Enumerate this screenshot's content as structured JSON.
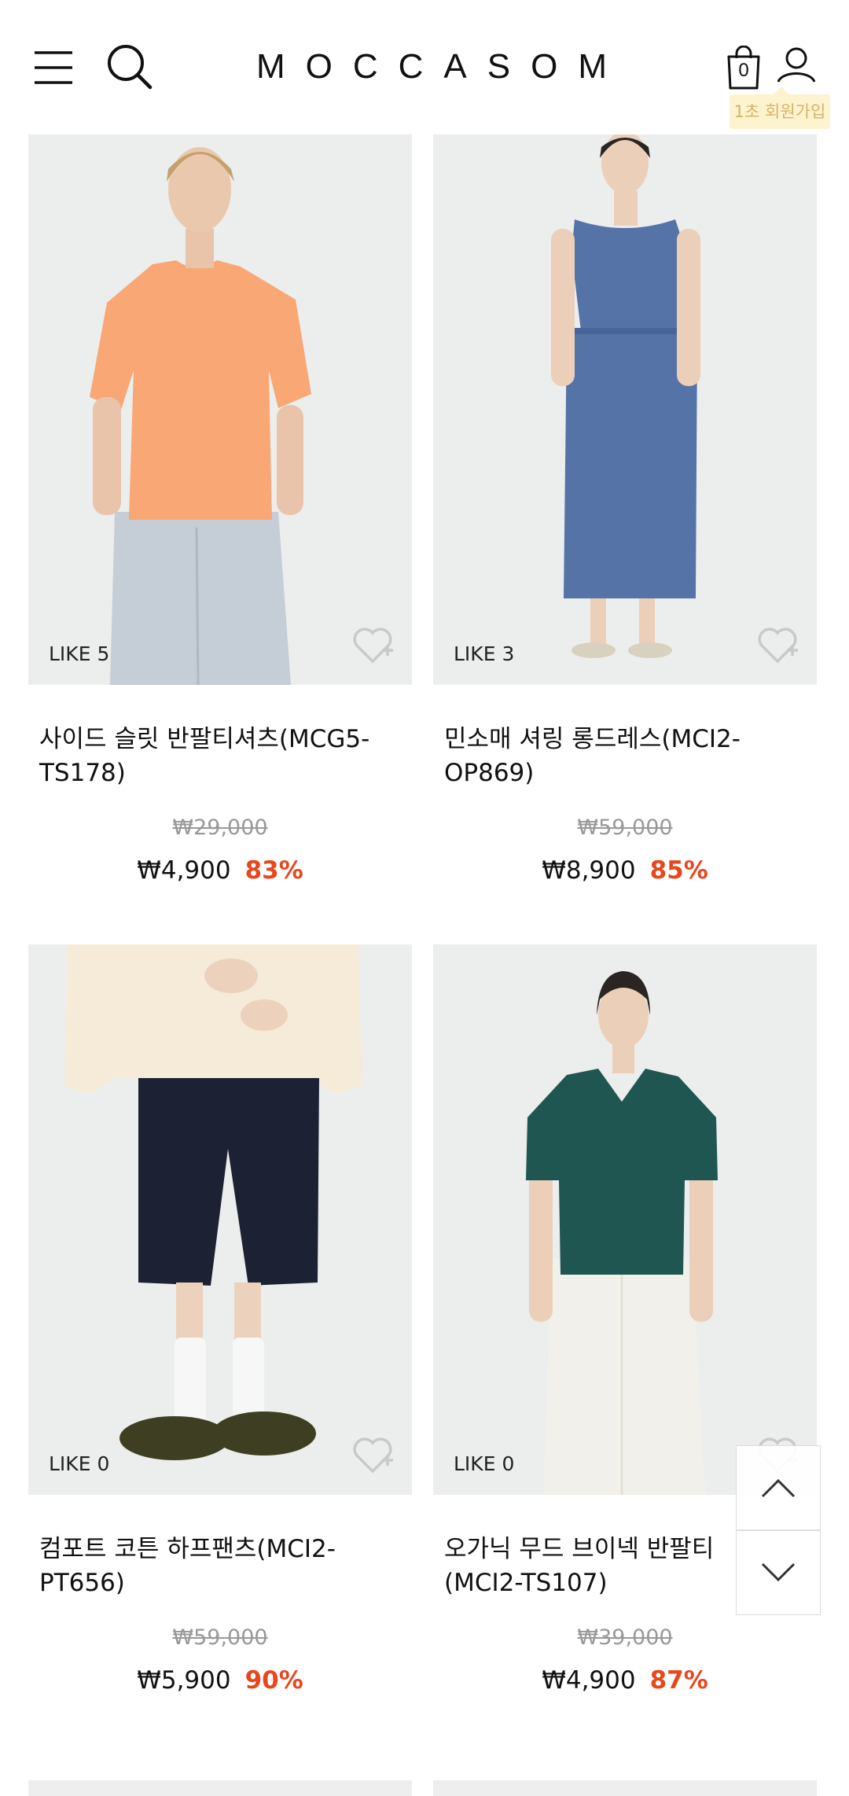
{
  "header": {
    "logo": "MOCCASOM",
    "cart_count": "0",
    "join_badge": "1초 회원가입",
    "icons": [
      "menu-icon",
      "search-icon",
      "shopping-bag-icon",
      "user-icon"
    ]
  },
  "products": [
    {
      "like": "LIKE 5",
      "name": "사이드 슬릿 반팔티셔츠(MCG5-TS178)",
      "original_price": "₩29,000",
      "price": "₩4,900",
      "discount": "83%",
      "colors": {
        "top": "#f8a775",
        "bottom": "#c5cdd6"
      }
    },
    {
      "like": "LIKE 3",
      "name": "민소매 셔링 롱드레스(MCI2-OP869)",
      "original_price": "₩59,000",
      "price": "₩8,900",
      "discount": "85%",
      "colors": {
        "dress": "#5573a6"
      }
    },
    {
      "like": "LIKE 0",
      "name": "컴포트 코튼 하프팬츠(MCI2-PT656)",
      "original_price": "₩59,000",
      "price": "₩5,900",
      "discount": "90%",
      "colors": {
        "top": "#f6ead8",
        "shorts": "#1c2233",
        "shoes": "#3e3f22"
      }
    },
    {
      "like": "LIKE 0",
      "name": "오가닉 무드 브이넥 반팔티\n(MCI2-TS107)",
      "original_price": "₩39,000",
      "price": "₩4,900",
      "discount": "87%",
      "colors": {
        "top": "#1f5651",
        "bottom": "#f2f0ea"
      }
    }
  ],
  "scroll_controls": [
    "chevron-up-icon",
    "chevron-down-icon"
  ],
  "accent_color": "#e8471e"
}
